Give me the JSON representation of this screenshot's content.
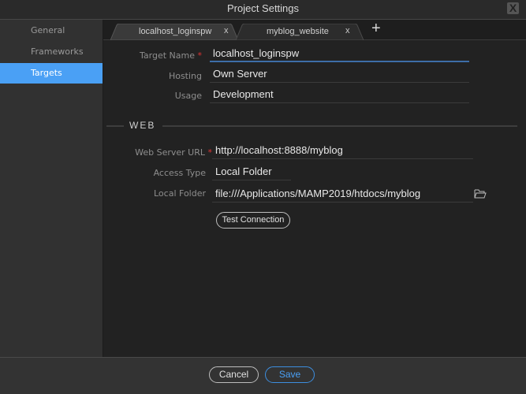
{
  "window": {
    "title": "Project Settings",
    "close_label": "X"
  },
  "sidebar": {
    "items": [
      {
        "label": "General",
        "active": false
      },
      {
        "label": "Frameworks",
        "active": false
      },
      {
        "label": "Targets",
        "active": true
      }
    ]
  },
  "tabs": {
    "items": [
      {
        "label": "localhost_loginspw",
        "close": "x",
        "active": true
      },
      {
        "label": "myblog_website",
        "close": "x",
        "active": false
      }
    ],
    "add_label": "+"
  },
  "form": {
    "target_name": {
      "label": "Target Name",
      "required": "*",
      "value": "localhost_loginspw"
    },
    "hosting": {
      "label": "Hosting",
      "value": "Own Server"
    },
    "usage": {
      "label": "Usage",
      "value": "Development"
    },
    "web_section": "WEB",
    "web_server_url": {
      "label": "Web Server URL",
      "required": "*",
      "value": "http://localhost:8888/myblog"
    },
    "access_type": {
      "label": "Access Type",
      "value": "Local Folder"
    },
    "local_folder": {
      "label": "Local Folder",
      "value": "file:///Applications/MAMP2019/htdocs/myblog",
      "icon": "folder-open-icon"
    },
    "test_connection_label": "Test Connection"
  },
  "footer": {
    "cancel_label": "Cancel",
    "save_label": "Save"
  },
  "colors": {
    "accent": "#4aa0f5",
    "required": "#dd3333",
    "focus_underline": "#3d6ea8"
  }
}
